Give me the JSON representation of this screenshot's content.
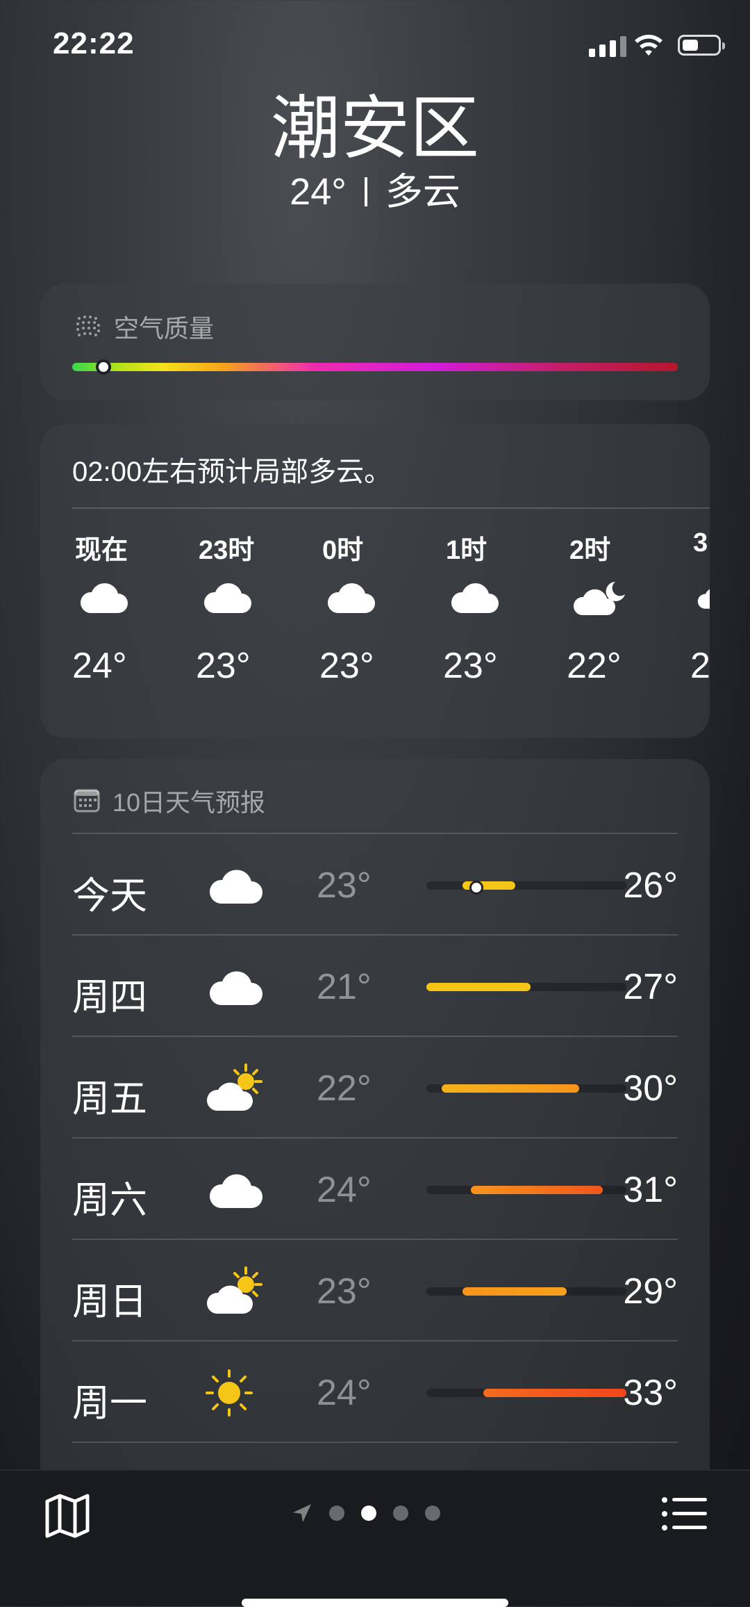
{
  "status_bar": {
    "time": "22:22"
  },
  "location": {
    "city": "潮安区",
    "temperature": "24°",
    "condition": "多云"
  },
  "air_quality": {
    "title": "空气质量",
    "icon": "aqi-dots-icon"
  },
  "hourly": {
    "summary": "02:00左右预计局部多云。",
    "items": [
      {
        "label": "现在",
        "temp": "24°",
        "icon": "cloud-icon"
      },
      {
        "label": "23时",
        "temp": "23°",
        "icon": "cloud-icon"
      },
      {
        "label": "0时",
        "temp": "23°",
        "icon": "cloud-icon"
      },
      {
        "label": "1时",
        "temp": "23°",
        "icon": "cloud-icon"
      },
      {
        "label": "2时",
        "temp": "22°",
        "icon": "cloud-moon-icon"
      },
      {
        "label": "3",
        "temp": "2",
        "icon": "cloud-icon"
      }
    ]
  },
  "daily": {
    "title": "10日天气预报",
    "days": [
      {
        "name": "今天",
        "low": "23°",
        "high": "26°",
        "icon": "cloud-icon"
      },
      {
        "name": "周四",
        "low": "21°",
        "high": "27°",
        "icon": "cloud-icon"
      },
      {
        "name": "周五",
        "low": "22°",
        "high": "30°",
        "icon": "partly-sunny-icon"
      },
      {
        "name": "周六",
        "low": "24°",
        "high": "31°",
        "icon": "cloud-icon"
      },
      {
        "name": "周日",
        "low": "23°",
        "high": "29°",
        "icon": "partly-sunny-icon"
      },
      {
        "name": "周一",
        "low": "24°",
        "high": "33°",
        "icon": "sun-icon"
      }
    ]
  },
  "colors": {
    "range_yellow": "#f5c518",
    "range_orange": "#f7941d",
    "range_red": "#f2561d"
  }
}
